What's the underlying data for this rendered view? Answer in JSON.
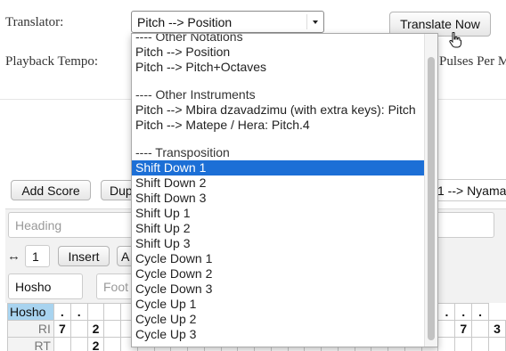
{
  "form": {
    "translator_label": "Translator:",
    "playback_tempo_label": "Playback Tempo:",
    "pulses_label": "Pulses Per M",
    "translator_selected": "Pitch --> Position",
    "translate_button": "Translate Now"
  },
  "dropdown_options": [
    {
      "label": "---- Other Notations",
      "kind": "header"
    },
    {
      "label": "Pitch --> Position",
      "kind": "option"
    },
    {
      "label": "Pitch --> Pitch+Octaves",
      "kind": "option"
    },
    {
      "label": "",
      "kind": "blank"
    },
    {
      "label": "---- Other Instruments",
      "kind": "header"
    },
    {
      "label": "Pitch --> Mbira dzavadzimu (with extra keys): Pitch",
      "kind": "option"
    },
    {
      "label": "Pitch --> Matepe / Hera: Pitch.4",
      "kind": "option"
    },
    {
      "label": "",
      "kind": "blank"
    },
    {
      "label": "---- Transposition",
      "kind": "header"
    },
    {
      "label": "Shift Down 1",
      "kind": "option",
      "selected": true
    },
    {
      "label": "Shift Down 2",
      "kind": "option"
    },
    {
      "label": "Shift Down 3",
      "kind": "option"
    },
    {
      "label": "Shift Up 1",
      "kind": "option"
    },
    {
      "label": "Shift Up 2",
      "kind": "option"
    },
    {
      "label": "Shift Up 3",
      "kind": "option"
    },
    {
      "label": "Cycle Down 1",
      "kind": "option"
    },
    {
      "label": "Cycle Down 2",
      "kind": "option"
    },
    {
      "label": "Cycle Down 3",
      "kind": "option"
    },
    {
      "label": "Cycle Up 1",
      "kind": "option"
    },
    {
      "label": "Cycle Up 2",
      "kind": "option"
    },
    {
      "label": "Cycle Up 3",
      "kind": "option"
    }
  ],
  "toolbar": {
    "add_score": "Add Score",
    "dup": "Dup",
    "right_select": "1 --> Nyama"
  },
  "editor": {
    "heading_placeholder": "Heading",
    "arrows_symbol": "↔",
    "count_value": "1",
    "insert_button": "Insert",
    "a_button": "A",
    "name_value": "Hosho",
    "footer_placeholder": "Foot"
  },
  "grid": {
    "rows": [
      {
        "label": "Hosho",
        "cells": [
          ".",
          ".",
          "",
          "",
          "",
          "",
          "",
          "",
          "",
          "",
          "",
          "",
          "",
          "",
          "",
          "",
          "",
          "",
          "",
          "",
          "",
          "",
          "",
          ".",
          ".",
          "."
        ]
      },
      {
        "label": "RI",
        "cells": [
          "7",
          "",
          "2",
          "",
          "",
          "",
          "",
          "",
          "",
          "",
          "",
          "",
          "",
          "",
          "",
          "",
          "",
          "",
          "",
          "",
          "",
          "",
          "",
          "",
          "7",
          "",
          "3"
        ]
      },
      {
        "label": "RT",
        "cells": [
          "",
          "",
          "2",
          "",
          "",
          "",
          "",
          "",
          "",
          "",
          "",
          "",
          "",
          "",
          "",
          "",
          "",
          "",
          "",
          "",
          "",
          "",
          "",
          "",
          "",
          "",
          ""
        ]
      }
    ]
  }
}
